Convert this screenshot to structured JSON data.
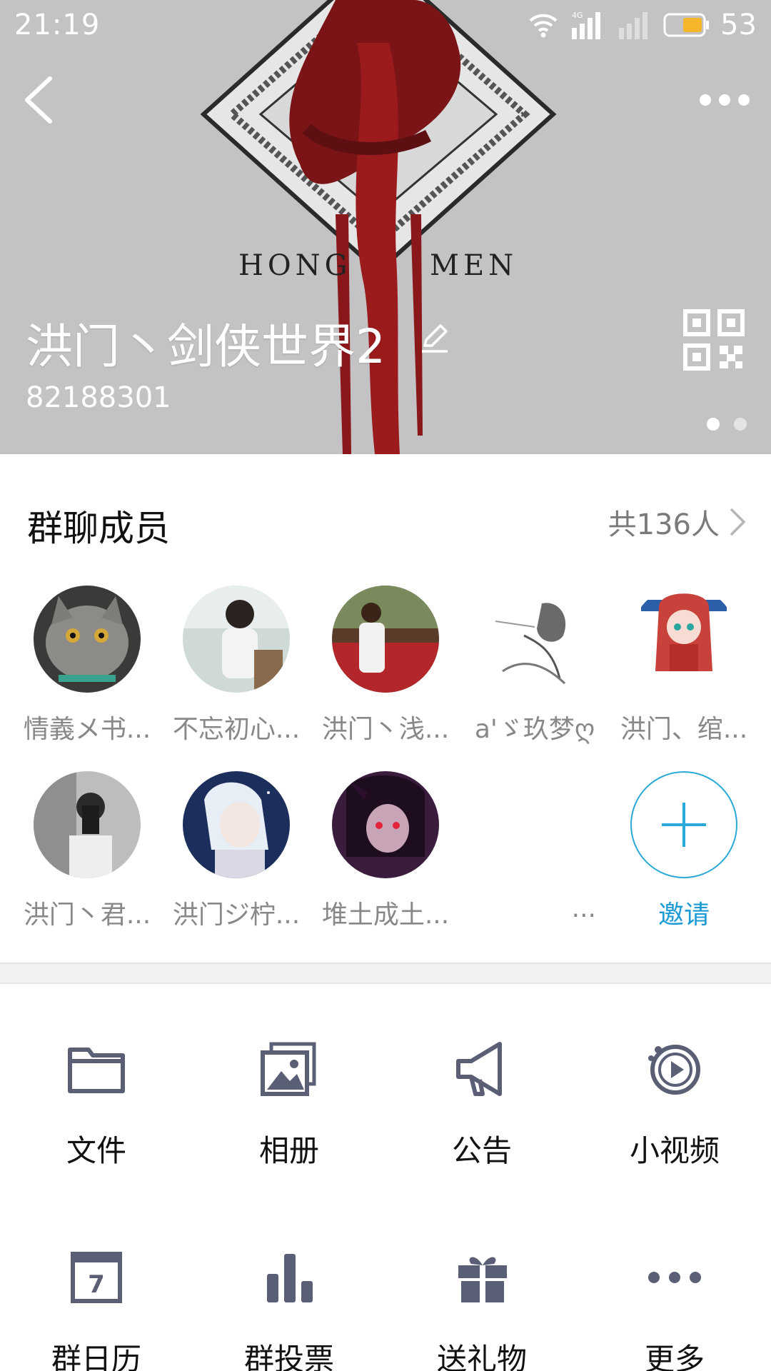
{
  "status": {
    "time": "21:19",
    "network": "4G",
    "battery": "53"
  },
  "header": {
    "group_name": "洪门丶剑侠世界2",
    "group_id": "82188301",
    "cover_text_left": "HONG",
    "cover_text_right": "MEN"
  },
  "members": {
    "title": "群聊成员",
    "count_label": "共136人",
    "list": [
      {
        "name": "情義メ书..."
      },
      {
        "name": "不忘初心..."
      },
      {
        "name": "洪门丶浅..."
      },
      {
        "name": "a'ゞ玖梦ღ"
      },
      {
        "name": "洪门、绾..."
      },
      {
        "name": "洪门丶君..."
      },
      {
        "name": "洪门ジ柠..."
      },
      {
        "name": "堆土成土..."
      },
      {
        "name": "..."
      }
    ],
    "invite_label": "邀请"
  },
  "functions": [
    {
      "label": "文件",
      "icon": "folder-icon"
    },
    {
      "label": "相册",
      "icon": "album-icon"
    },
    {
      "label": "公告",
      "icon": "megaphone-icon"
    },
    {
      "label": "小视频",
      "icon": "video-icon"
    },
    {
      "label": "群日历",
      "icon": "calendar-icon"
    },
    {
      "label": "群投票",
      "icon": "vote-icon"
    },
    {
      "label": "送礼物",
      "icon": "gift-icon"
    },
    {
      "label": "更多",
      "icon": "more-icon"
    }
  ],
  "colors": {
    "accent": "#1a9ad6",
    "icon": "#5b5f75",
    "header_bg": "#c3c3c5"
  }
}
